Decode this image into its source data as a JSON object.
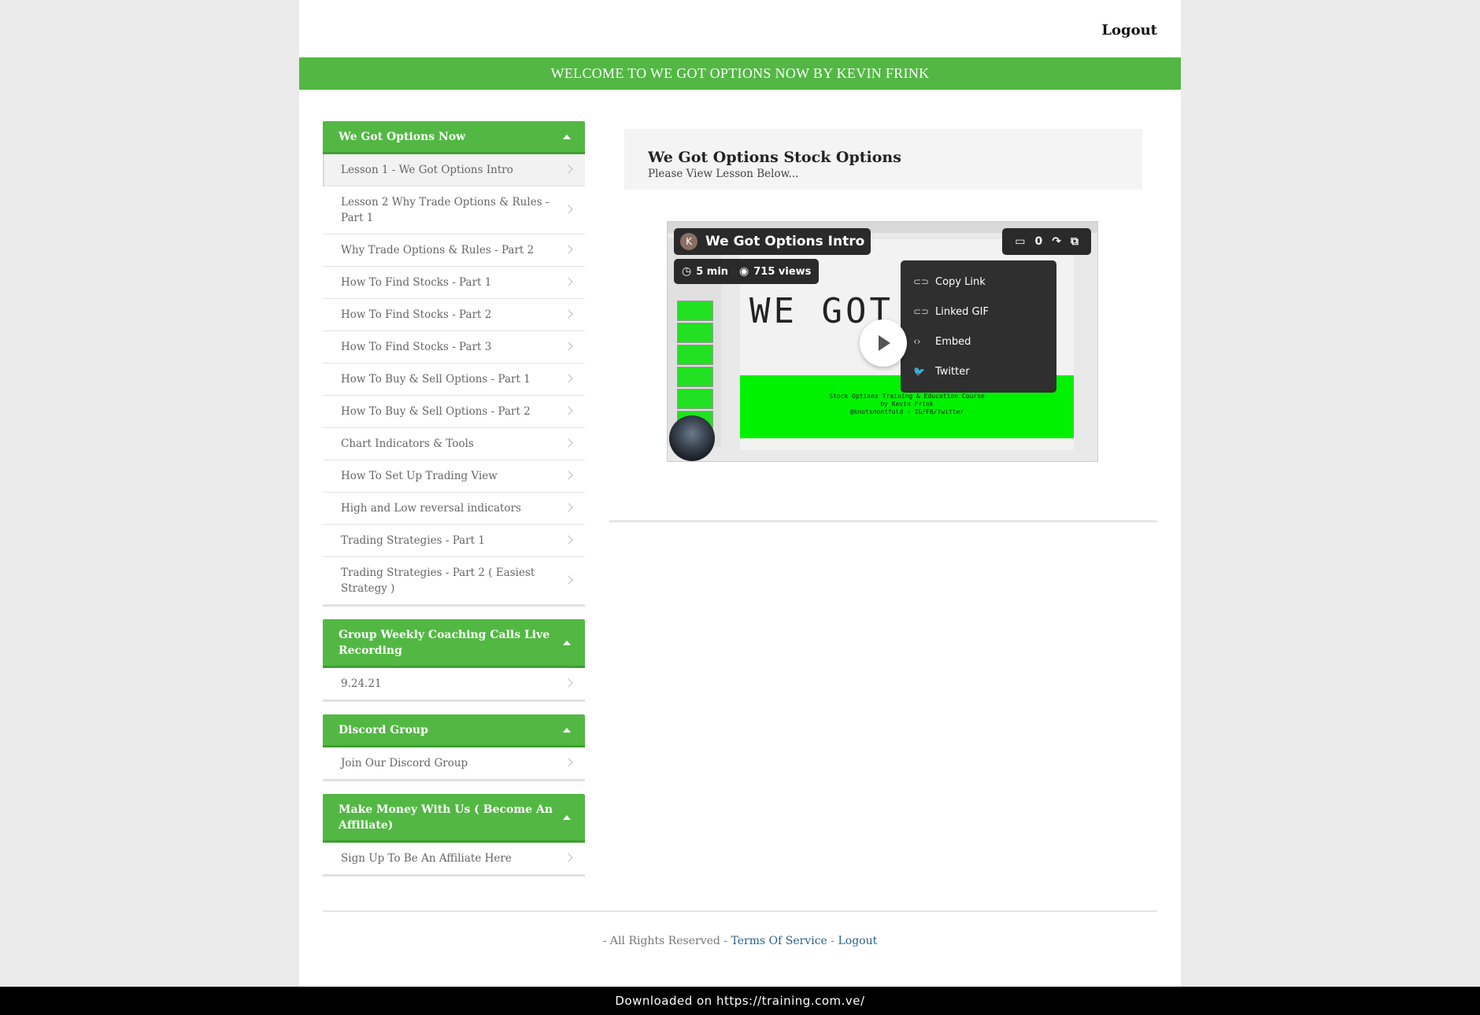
{
  "header": {
    "logout_label": "Logout"
  },
  "welcome_banner": "WELCOME TO WE GOT OPTIONS NOW BY KEVIN FRINK",
  "sidebar": {
    "sections": [
      {
        "title": "We Got Options Now",
        "items": [
          "Lesson 1 - We Got Options Intro",
          "Lesson 2 Why Trade Options & Rules - Part 1",
          "Why Trade Options & Rules - Part 2",
          "How To Find Stocks - Part 1",
          "How To Find Stocks - Part 2",
          "How To Find Stocks - Part 3",
          "How To Buy & Sell Options - Part 1",
          "How To Buy & Sell Options - Part 2",
          "Chart Indicators & Tools",
          "How To Set Up Trading View",
          "High and Low reversal indicators",
          "Trading Strategies - Part 1",
          "Trading Strategies - Part 2 ( Easiest Strategy )"
        ]
      },
      {
        "title": "Group Weekly Coaching Calls Live Recording",
        "items": [
          "9.24.21"
        ]
      },
      {
        "title": "Discord Group",
        "items": [
          "Join Our Discord Group"
        ]
      },
      {
        "title": "Make Money With Us ( Become An Affiliate)",
        "items": [
          "Sign Up To Be An Affiliate Here"
        ]
      }
    ]
  },
  "lesson": {
    "title": "We Got Options Stock Options",
    "subtitle": "Please View Lesson Below..."
  },
  "video": {
    "avatar_letter": "K",
    "title": "We Got Options Intro",
    "duration": "5 min",
    "views": "715 views",
    "comment_count": "0",
    "slide_title": "WE GOT",
    "slide_line1": "Stock Options Training & Education Course",
    "slide_line2": "by Kevin Frink",
    "slide_line3": "@knotsdontfold - IG/FB/Twitter",
    "share_menu": [
      "Copy Link",
      "Linked GIF",
      "Embed",
      "Twitter"
    ]
  },
  "footer": {
    "text": "- All Rights Reserved -",
    "terms_label": "Terms Of Service",
    "separator": "-",
    "logout_label": "Logout"
  },
  "download_bar": "Downloaded on https://training.com.ve/",
  "colors": {
    "brand_green": "#52b843",
    "link_blue": "#2c5f8a"
  }
}
